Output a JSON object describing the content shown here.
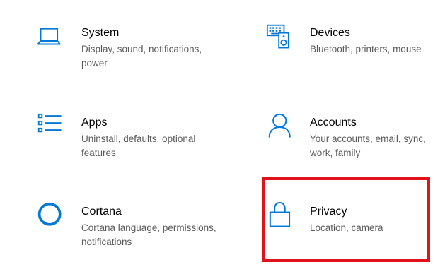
{
  "accent_color": "#0078d7",
  "highlight_color": "#e0121a",
  "tiles": [
    {
      "id": "system",
      "icon": "laptop-icon",
      "title": "System",
      "description": "Display, sound, notifications, power"
    },
    {
      "id": "devices",
      "icon": "devices-icon",
      "title": "Devices",
      "description": "Bluetooth, printers, mouse"
    },
    {
      "id": "apps",
      "icon": "apps-list-icon",
      "title": "Apps",
      "description": "Uninstall, defaults, optional features"
    },
    {
      "id": "accounts",
      "icon": "person-icon",
      "title": "Accounts",
      "description": "Your accounts, email, sync, work, family"
    },
    {
      "id": "cortana",
      "icon": "cortana-circle-icon",
      "title": "Cortana",
      "description": "Cortana language, permissions, notifications"
    },
    {
      "id": "privacy",
      "icon": "padlock-icon",
      "title": "Privacy",
      "description": "Location, camera",
      "highlighted": true
    }
  ]
}
